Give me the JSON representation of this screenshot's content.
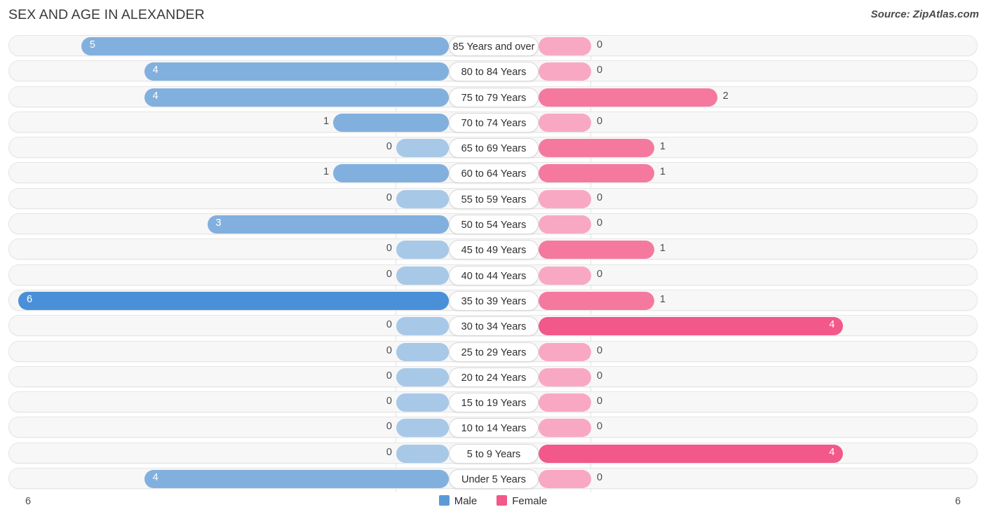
{
  "header": {
    "title": "SEX AND AGE IN ALEXANDER",
    "source": "Source: ZipAtlas.com"
  },
  "legend": {
    "male_label": "Male",
    "female_label": "Female",
    "male_color": "#5b9bd5",
    "female_color": "#f2588a"
  },
  "axis": {
    "left_max": "6",
    "right_max": "6"
  },
  "colors": {
    "male_stub": "#a8c8e8",
    "male_mid": "#82b0de",
    "male_max": "#4a90d9",
    "female_stub": "#f9a8c4",
    "female_mid": "#f5799f",
    "female_max": "#f2588a",
    "row_background": "#f7f7f7",
    "row_border": "#e6e6e6",
    "pill_background": "#ffffff"
  },
  "chart_data": {
    "type": "bar",
    "title": "SEX AND AGE IN ALEXANDER",
    "subtitle": "Source: ZipAtlas.com",
    "orientation": "horizontal-diverging",
    "xlabel": "",
    "ylabel": "",
    "xlim": [
      6,
      6
    ],
    "grid": false,
    "legend_position": "bottom-center",
    "categories": [
      "85 Years and over",
      "80 to 84 Years",
      "75 to 79 Years",
      "70 to 74 Years",
      "65 to 69 Years",
      "60 to 64 Years",
      "55 to 59 Years",
      "50 to 54 Years",
      "45 to 49 Years",
      "40 to 44 Years",
      "35 to 39 Years",
      "30 to 34 Years",
      "25 to 29 Years",
      "20 to 24 Years",
      "15 to 19 Years",
      "10 to 14 Years",
      "5 to 9 Years",
      "Under 5 Years"
    ],
    "series": [
      {
        "name": "Male",
        "color": "#5b9bd5",
        "values": [
          5,
          4,
          4,
          1,
          0,
          1,
          0,
          3,
          0,
          0,
          6,
          0,
          0,
          0,
          0,
          0,
          0,
          4
        ]
      },
      {
        "name": "Female",
        "color": "#f2588a",
        "values": [
          0,
          0,
          2,
          0,
          1,
          1,
          0,
          0,
          1,
          0,
          1,
          4,
          0,
          0,
          0,
          0,
          4,
          0
        ]
      }
    ]
  },
  "rows": [
    {
      "label": "85 Years and over",
      "male": "5",
      "female": "0"
    },
    {
      "label": "80 to 84 Years",
      "male": "4",
      "female": "0"
    },
    {
      "label": "75 to 79 Years",
      "male": "4",
      "female": "2"
    },
    {
      "label": "70 to 74 Years",
      "male": "1",
      "female": "0"
    },
    {
      "label": "65 to 69 Years",
      "male": "0",
      "female": "1"
    },
    {
      "label": "60 to 64 Years",
      "male": "1",
      "female": "1"
    },
    {
      "label": "55 to 59 Years",
      "male": "0",
      "female": "0"
    },
    {
      "label": "50 to 54 Years",
      "male": "3",
      "female": "0"
    },
    {
      "label": "45 to 49 Years",
      "male": "0",
      "female": "1"
    },
    {
      "label": "40 to 44 Years",
      "male": "0",
      "female": "0"
    },
    {
      "label": "35 to 39 Years",
      "male": "6",
      "female": "1"
    },
    {
      "label": "30 to 34 Years",
      "male": "0",
      "female": "4"
    },
    {
      "label": "25 to 29 Years",
      "male": "0",
      "female": "0"
    },
    {
      "label": "20 to 24 Years",
      "male": "0",
      "female": "0"
    },
    {
      "label": "15 to 19 Years",
      "male": "0",
      "female": "0"
    },
    {
      "label": "10 to 14 Years",
      "male": "0",
      "female": "0"
    },
    {
      "label": "5 to 9 Years",
      "male": "0",
      "female": "4"
    },
    {
      "label": "Under 5 Years",
      "male": "4",
      "female": "0"
    }
  ]
}
